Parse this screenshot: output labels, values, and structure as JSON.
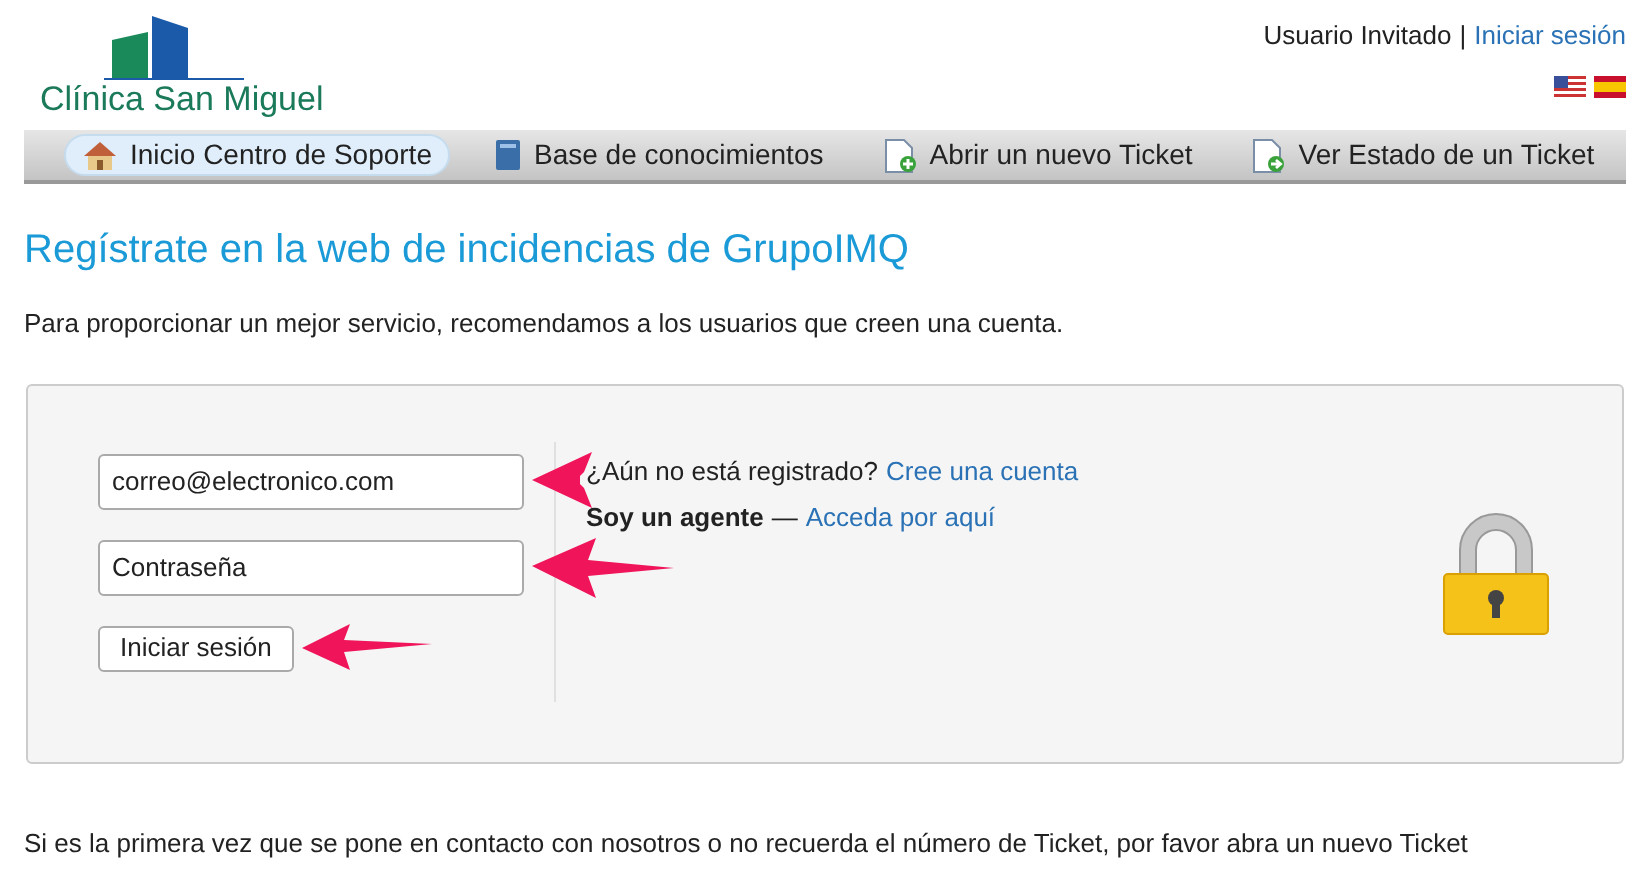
{
  "header": {
    "logo_text": "Clínica San Miguel",
    "user_label": "Usuario Invitado",
    "separator": "|",
    "login_link": "Iniciar sesión",
    "languages": [
      {
        "kind": "us"
      },
      {
        "kind": "es"
      }
    ]
  },
  "nav": [
    {
      "label": "Inicio Centro de Soporte",
      "kind": "home",
      "selected": true
    },
    {
      "label": "Base de conocimientos",
      "kind": "book",
      "selected": false
    },
    {
      "label": "Abrir un nuevo Ticket",
      "kind": "new",
      "selected": false
    },
    {
      "label": "Ver Estado de un Ticket",
      "kind": "status",
      "selected": false
    }
  ],
  "title": "Regístrate en la web de incidencias de GrupoIMQ",
  "intro": "Para proporcionar un mejor servicio, recomendamos a los usuarios que creen una cuenta.",
  "login": {
    "email_value": "correo@electronico.com",
    "password_placeholder": "Contraseña",
    "submit": "Iniciar sesión"
  },
  "register": {
    "question": "¿Aún no está registrado?",
    "register_link": "Cree una cuenta",
    "agent_label": "Soy un agente",
    "dash": "—",
    "agent_link": "Acceda por aquí"
  },
  "footer_note": "Si es la primera vez que se pone en contacto con nosotros o no recuerda el número de Ticket, por favor abra un nuevo Ticket"
}
